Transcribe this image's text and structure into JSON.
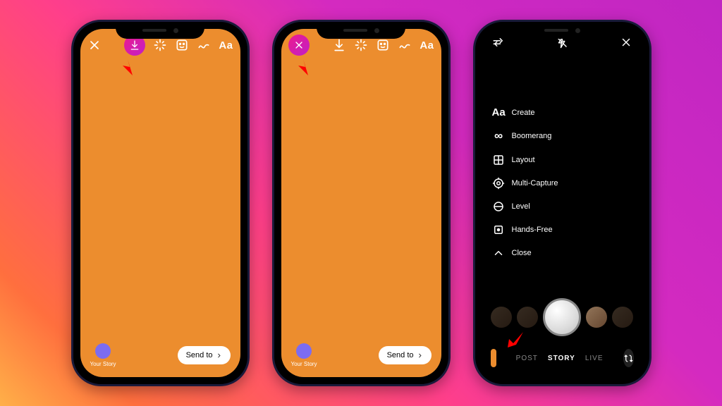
{
  "editor": {
    "send_to_label": "Send to",
    "your_story_label": "Your Story",
    "text_tool": "Aa"
  },
  "camera": {
    "tools": [
      {
        "icon": "aa",
        "label": "Create"
      },
      {
        "icon": "infinity",
        "label": "Boomerang"
      },
      {
        "icon": "layout",
        "label": "Layout"
      },
      {
        "icon": "multicapture",
        "label": "Multi-Capture"
      },
      {
        "icon": "level",
        "label": "Level"
      },
      {
        "icon": "handsfree",
        "label": "Hands-Free"
      },
      {
        "icon": "close-menu",
        "label": "Close"
      }
    ],
    "modes": {
      "post": "POST",
      "story": "STORY",
      "live": "LIVE"
    }
  },
  "colors": {
    "canvas": "#EC8D2E",
    "highlight_gradient_a": "#ec1b8d",
    "highlight_gradient_b": "#c11fc7",
    "arrow": "#ff0000"
  }
}
